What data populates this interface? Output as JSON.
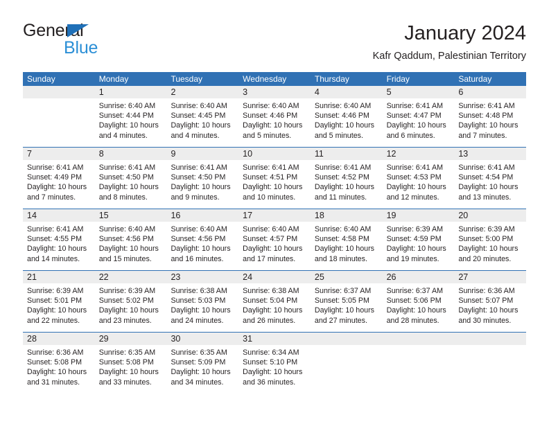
{
  "brand": {
    "name_dark": "General",
    "name_blue": "Blue",
    "triangle_icon": "triangle-icon",
    "accent_blue": "#2b8fd6",
    "logo_blue": "#1f70b8"
  },
  "header": {
    "title": "January 2024",
    "subtitle": "Kafr Qaddum, Palestinian Territory"
  },
  "theme": {
    "header_blue": "#3071b4",
    "number_strip_gray": "#ededed",
    "text_color": "#231f20"
  },
  "calendar": {
    "weekday_headers": [
      "Sunday",
      "Monday",
      "Tuesday",
      "Wednesday",
      "Thursday",
      "Friday",
      "Saturday"
    ],
    "weeks": [
      [
        {
          "day": "",
          "sunrise": "",
          "sunset": "",
          "daylight_line1": "",
          "daylight_line2": "",
          "empty": true
        },
        {
          "day": "1",
          "sunrise": "Sunrise: 6:40 AM",
          "sunset": "Sunset: 4:44 PM",
          "daylight_line1": "Daylight: 10 hours",
          "daylight_line2": "and 4 minutes."
        },
        {
          "day": "2",
          "sunrise": "Sunrise: 6:40 AM",
          "sunset": "Sunset: 4:45 PM",
          "daylight_line1": "Daylight: 10 hours",
          "daylight_line2": "and 4 minutes."
        },
        {
          "day": "3",
          "sunrise": "Sunrise: 6:40 AM",
          "sunset": "Sunset: 4:46 PM",
          "daylight_line1": "Daylight: 10 hours",
          "daylight_line2": "and 5 minutes."
        },
        {
          "day": "4",
          "sunrise": "Sunrise: 6:40 AM",
          "sunset": "Sunset: 4:46 PM",
          "daylight_line1": "Daylight: 10 hours",
          "daylight_line2": "and 5 minutes."
        },
        {
          "day": "5",
          "sunrise": "Sunrise: 6:41 AM",
          "sunset": "Sunset: 4:47 PM",
          "daylight_line1": "Daylight: 10 hours",
          "daylight_line2": "and 6 minutes."
        },
        {
          "day": "6",
          "sunrise": "Sunrise: 6:41 AM",
          "sunset": "Sunset: 4:48 PM",
          "daylight_line1": "Daylight: 10 hours",
          "daylight_line2": "and 7 minutes."
        }
      ],
      [
        {
          "day": "7",
          "sunrise": "Sunrise: 6:41 AM",
          "sunset": "Sunset: 4:49 PM",
          "daylight_line1": "Daylight: 10 hours",
          "daylight_line2": "and 7 minutes."
        },
        {
          "day": "8",
          "sunrise": "Sunrise: 6:41 AM",
          "sunset": "Sunset: 4:50 PM",
          "daylight_line1": "Daylight: 10 hours",
          "daylight_line2": "and 8 minutes."
        },
        {
          "day": "9",
          "sunrise": "Sunrise: 6:41 AM",
          "sunset": "Sunset: 4:50 PM",
          "daylight_line1": "Daylight: 10 hours",
          "daylight_line2": "and 9 minutes."
        },
        {
          "day": "10",
          "sunrise": "Sunrise: 6:41 AM",
          "sunset": "Sunset: 4:51 PM",
          "daylight_line1": "Daylight: 10 hours",
          "daylight_line2": "and 10 minutes."
        },
        {
          "day": "11",
          "sunrise": "Sunrise: 6:41 AM",
          "sunset": "Sunset: 4:52 PM",
          "daylight_line1": "Daylight: 10 hours",
          "daylight_line2": "and 11 minutes."
        },
        {
          "day": "12",
          "sunrise": "Sunrise: 6:41 AM",
          "sunset": "Sunset: 4:53 PM",
          "daylight_line1": "Daylight: 10 hours",
          "daylight_line2": "and 12 minutes."
        },
        {
          "day": "13",
          "sunrise": "Sunrise: 6:41 AM",
          "sunset": "Sunset: 4:54 PM",
          "daylight_line1": "Daylight: 10 hours",
          "daylight_line2": "and 13 minutes."
        }
      ],
      [
        {
          "day": "14",
          "sunrise": "Sunrise: 6:41 AM",
          "sunset": "Sunset: 4:55 PM",
          "daylight_line1": "Daylight: 10 hours",
          "daylight_line2": "and 14 minutes."
        },
        {
          "day": "15",
          "sunrise": "Sunrise: 6:40 AM",
          "sunset": "Sunset: 4:56 PM",
          "daylight_line1": "Daylight: 10 hours",
          "daylight_line2": "and 15 minutes."
        },
        {
          "day": "16",
          "sunrise": "Sunrise: 6:40 AM",
          "sunset": "Sunset: 4:56 PM",
          "daylight_line1": "Daylight: 10 hours",
          "daylight_line2": "and 16 minutes."
        },
        {
          "day": "17",
          "sunrise": "Sunrise: 6:40 AM",
          "sunset": "Sunset: 4:57 PM",
          "daylight_line1": "Daylight: 10 hours",
          "daylight_line2": "and 17 minutes."
        },
        {
          "day": "18",
          "sunrise": "Sunrise: 6:40 AM",
          "sunset": "Sunset: 4:58 PM",
          "daylight_line1": "Daylight: 10 hours",
          "daylight_line2": "and 18 minutes."
        },
        {
          "day": "19",
          "sunrise": "Sunrise: 6:39 AM",
          "sunset": "Sunset: 4:59 PM",
          "daylight_line1": "Daylight: 10 hours",
          "daylight_line2": "and 19 minutes."
        },
        {
          "day": "20",
          "sunrise": "Sunrise: 6:39 AM",
          "sunset": "Sunset: 5:00 PM",
          "daylight_line1": "Daylight: 10 hours",
          "daylight_line2": "and 20 minutes."
        }
      ],
      [
        {
          "day": "21",
          "sunrise": "Sunrise: 6:39 AM",
          "sunset": "Sunset: 5:01 PM",
          "daylight_line1": "Daylight: 10 hours",
          "daylight_line2": "and 22 minutes."
        },
        {
          "day": "22",
          "sunrise": "Sunrise: 6:39 AM",
          "sunset": "Sunset: 5:02 PM",
          "daylight_line1": "Daylight: 10 hours",
          "daylight_line2": "and 23 minutes."
        },
        {
          "day": "23",
          "sunrise": "Sunrise: 6:38 AM",
          "sunset": "Sunset: 5:03 PM",
          "daylight_line1": "Daylight: 10 hours",
          "daylight_line2": "and 24 minutes."
        },
        {
          "day": "24",
          "sunrise": "Sunrise: 6:38 AM",
          "sunset": "Sunset: 5:04 PM",
          "daylight_line1": "Daylight: 10 hours",
          "daylight_line2": "and 26 minutes."
        },
        {
          "day": "25",
          "sunrise": "Sunrise: 6:37 AM",
          "sunset": "Sunset: 5:05 PM",
          "daylight_line1": "Daylight: 10 hours",
          "daylight_line2": "and 27 minutes."
        },
        {
          "day": "26",
          "sunrise": "Sunrise: 6:37 AM",
          "sunset": "Sunset: 5:06 PM",
          "daylight_line1": "Daylight: 10 hours",
          "daylight_line2": "and 28 minutes."
        },
        {
          "day": "27",
          "sunrise": "Sunrise: 6:36 AM",
          "sunset": "Sunset: 5:07 PM",
          "daylight_line1": "Daylight: 10 hours",
          "daylight_line2": "and 30 minutes."
        }
      ],
      [
        {
          "day": "28",
          "sunrise": "Sunrise: 6:36 AM",
          "sunset": "Sunset: 5:08 PM",
          "daylight_line1": "Daylight: 10 hours",
          "daylight_line2": "and 31 minutes."
        },
        {
          "day": "29",
          "sunrise": "Sunrise: 6:35 AM",
          "sunset": "Sunset: 5:08 PM",
          "daylight_line1": "Daylight: 10 hours",
          "daylight_line2": "and 33 minutes."
        },
        {
          "day": "30",
          "sunrise": "Sunrise: 6:35 AM",
          "sunset": "Sunset: 5:09 PM",
          "daylight_line1": "Daylight: 10 hours",
          "daylight_line2": "and 34 minutes."
        },
        {
          "day": "31",
          "sunrise": "Sunrise: 6:34 AM",
          "sunset": "Sunset: 5:10 PM",
          "daylight_line1": "Daylight: 10 hours",
          "daylight_line2": "and 36 minutes."
        },
        {
          "day": "",
          "sunrise": "",
          "sunset": "",
          "daylight_line1": "",
          "daylight_line2": "",
          "empty": true
        },
        {
          "day": "",
          "sunrise": "",
          "sunset": "",
          "daylight_line1": "",
          "daylight_line2": "",
          "empty": true
        },
        {
          "day": "",
          "sunrise": "",
          "sunset": "",
          "daylight_line1": "",
          "daylight_line2": "",
          "empty": true
        }
      ]
    ]
  }
}
